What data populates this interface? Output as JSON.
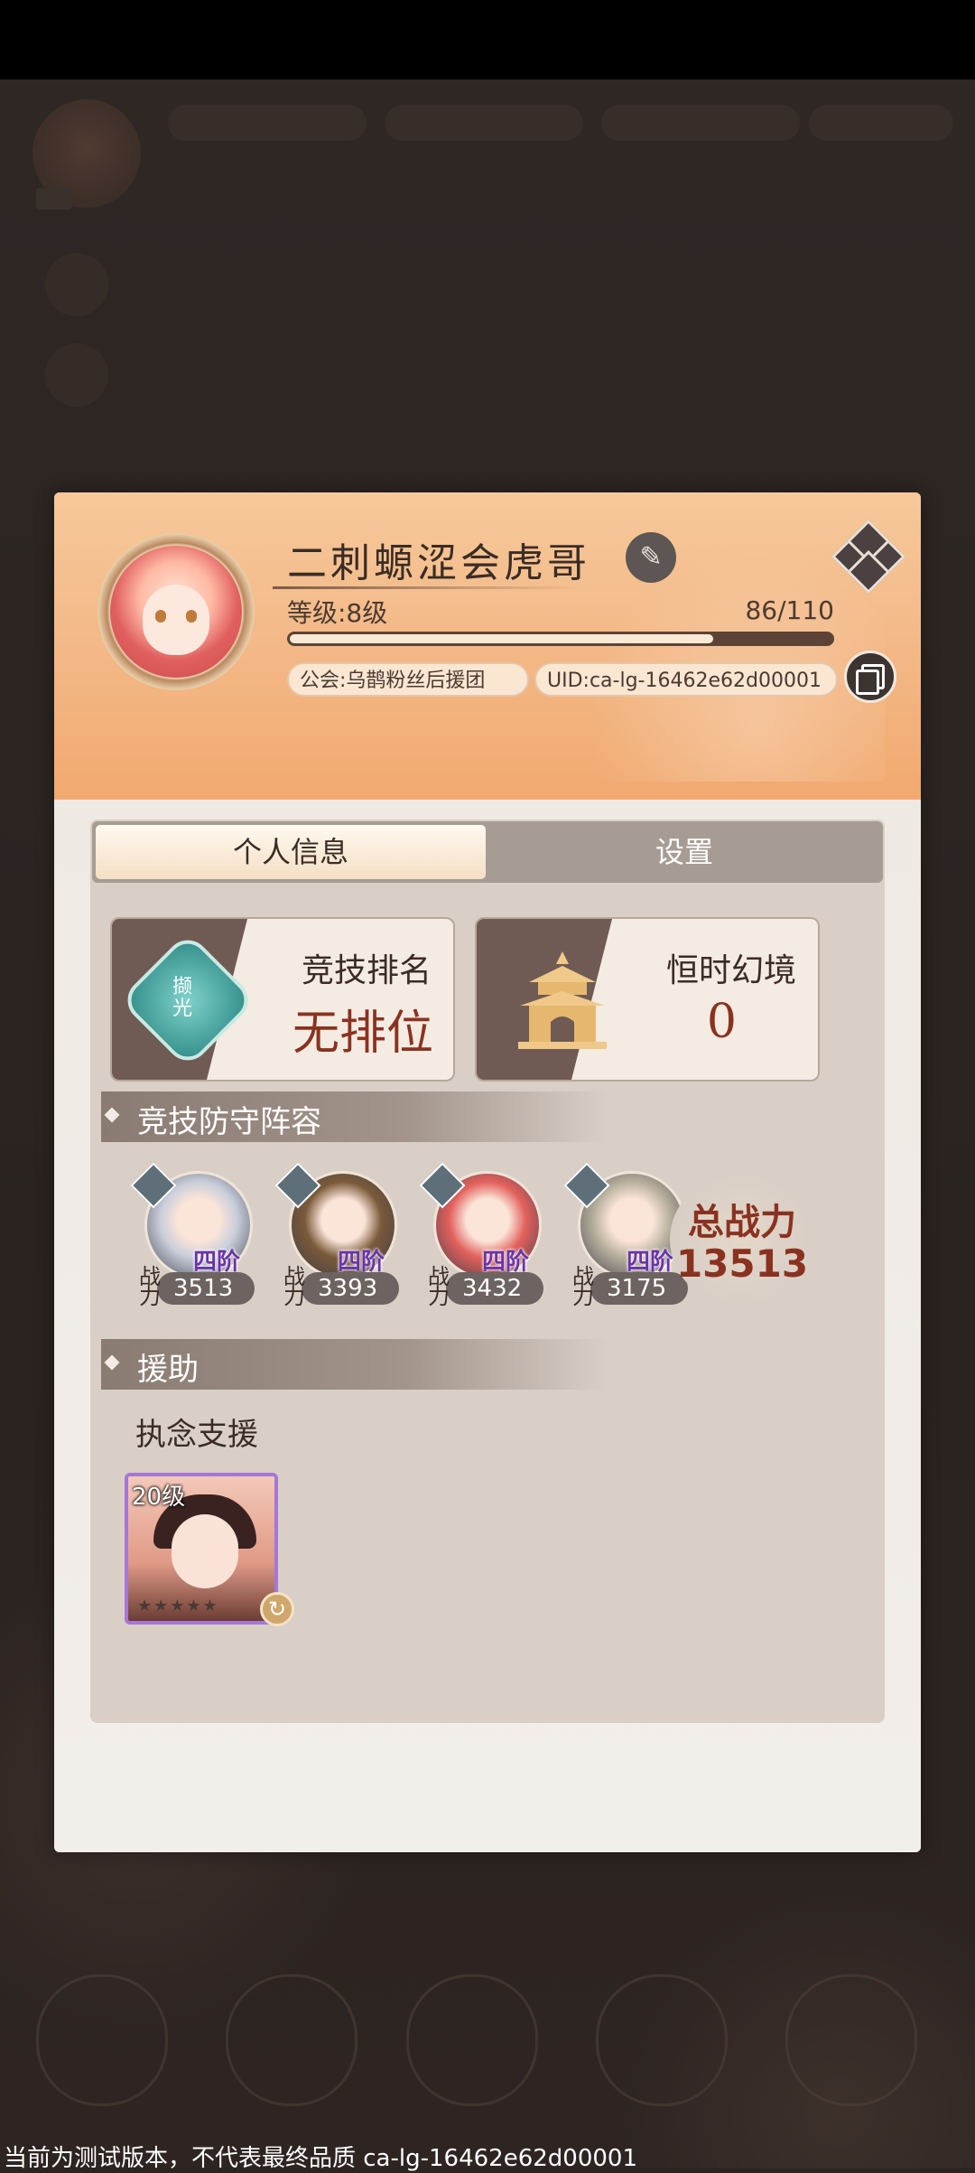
{
  "profile": {
    "name": "二刺螈涩会虎哥",
    "level_label": "等级:8级",
    "exp_text": "86/110",
    "exp_fraction": 0.782,
    "guild": "公会:乌鹊粉丝后援团",
    "uid": "UID:ca-lg-16462e62d00001"
  },
  "tabs": [
    {
      "label": "个人信息",
      "active": true
    },
    {
      "label": "设置",
      "active": false
    }
  ],
  "stats": {
    "arena": {
      "title": "竞技排名",
      "value": "无排位",
      "emblem_text": "撷光"
    },
    "realm": {
      "title": "恒时幻境",
      "value": "0"
    }
  },
  "defense": {
    "header": "竞技防守阵容",
    "power_label": "战力",
    "heroes": [
      {
        "rank": "四阶",
        "power": "3513",
        "color": "#c9cedb"
      },
      {
        "rank": "四阶",
        "power": "3393",
        "color": "#7a5a3a"
      },
      {
        "rank": "四阶",
        "power": "3432",
        "color": "#e2615c"
      },
      {
        "rank": "四阶",
        "power": "3175",
        "color": "#b8b09d"
      }
    ],
    "total_label": "总战力",
    "total_value": "13513"
  },
  "assist": {
    "header": "援助",
    "sub_label": "执念支援",
    "card_level": "20级"
  },
  "footer_text": "当前为测试版本，不代表最终品质 ca-lg-16462e62d00001"
}
